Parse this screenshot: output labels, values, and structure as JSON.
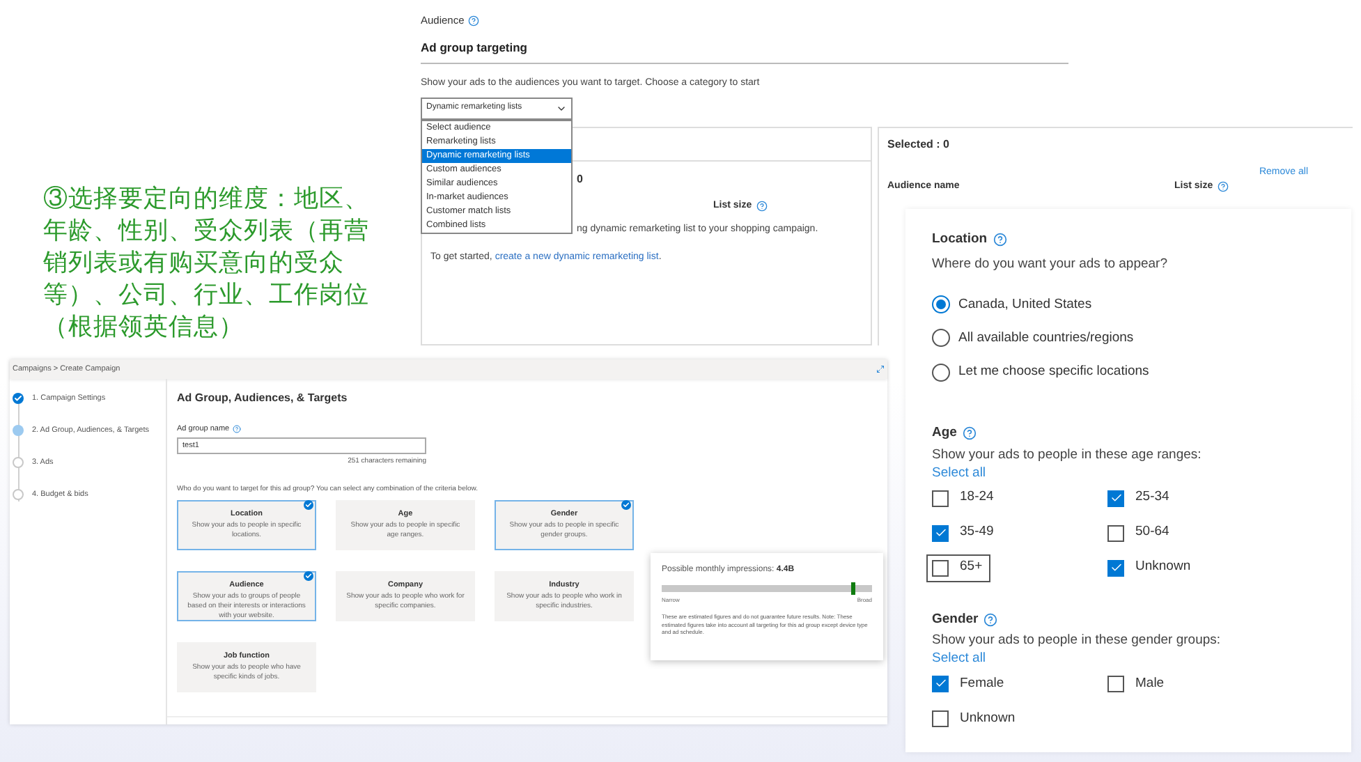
{
  "annotation": "③选择要定向的维度：地区、年龄、性别、受众列表（再营销列表或有购买意向的受众等）、公司、行业、工作岗位（根据领英信息）",
  "audience_panel": {
    "label": "Audience",
    "heading": "Ad group targeting",
    "instruction": "Show your ads to the audiences you want to target. Choose a category to start",
    "dropdown": {
      "value": "Dynamic remarketing lists",
      "expanded": true,
      "options": [
        {
          "label": "Select audience",
          "selected": false
        },
        {
          "label": "Remarketing lists",
          "selected": false
        },
        {
          "label": "Dynamic remarketing lists",
          "selected": true
        },
        {
          "label": "Custom audiences",
          "selected": false
        },
        {
          "label": "Similar audiences",
          "selected": false
        },
        {
          "label": "In-market audiences",
          "selected": false
        },
        {
          "label": "Customer match lists",
          "selected": false
        },
        {
          "label": "Combined lists",
          "selected": false
        }
      ]
    },
    "list_panel": {
      "count": "0",
      "list_size": "List size",
      "message": "ng dynamic remarketing list to your shopping campaign.",
      "prompt": "To get started,",
      "link": "create a new dynamic remarketing list",
      "link_end": "."
    },
    "selected_panel": {
      "title": "Selected : 0",
      "remove_all": "Remove all",
      "name_column": "Audience name",
      "size_column": "List size"
    }
  },
  "wizard": {
    "breadcrumb": "Campaigns > Create Campaign",
    "steps": [
      {
        "label": "1. Campaign Settings",
        "kind": "done"
      },
      {
        "label": "2. Ad Group, Audiences, & Targets",
        "kind": "current"
      },
      {
        "label": "3. Ads",
        "kind": "todo"
      },
      {
        "label": "4. Budget & bids",
        "kind": "todo"
      }
    ],
    "title": "Ad Group, Audiences, & Targets",
    "name_label": "Ad group name",
    "name_value": "test1",
    "remaining": "251 characters remaining",
    "question": "Who do you want to target for this ad group? You can select any combination of the criteria below.",
    "criteria": [
      {
        "title": "Location",
        "description": "Show your ads to people in specific locations.",
        "selected": true
      },
      {
        "title": "Age",
        "description": "Show your ads to people in specific age ranges.",
        "selected": false
      },
      {
        "title": "Gender",
        "description": "Show your ads to people in specific gender groups.",
        "selected": true
      },
      {
        "title": "Audience",
        "description": "Show your ads to groups of people based on their interests or interactions with your website.",
        "selected": true
      },
      {
        "title": "Company",
        "description": "Show your ads to people who work for specific companies.",
        "selected": false
      },
      {
        "title": "Industry",
        "description": "Show your ads to people who work in specific industries.",
        "selected": false
      },
      {
        "title": "Job function",
        "description": "Show your ads to people who have specific kinds of jobs.",
        "selected": false
      }
    ],
    "impressions": {
      "label": "Possible monthly impressions:",
      "value": "4.4B",
      "level": 0.9,
      "low": "Narrow",
      "high": "Broad",
      "note": "These are estimated figures and do not guarantee future results. Note: These estimated figures take into account all targeting for this ad group except device type and ad schedule."
    }
  },
  "targeting": {
    "location": {
      "title": "Location",
      "question": "Where do you want your ads to appear?",
      "options": [
        {
          "label": "Canada, United States",
          "selected": true
        },
        {
          "label": "All available countries/regions",
          "selected": false
        },
        {
          "label": "Let me choose specific locations",
          "selected": false
        }
      ]
    },
    "age": {
      "title": "Age",
      "question": "Show your ads to people in these age ranges:",
      "select_all": "Select all",
      "options": [
        {
          "label": "18-24",
          "checked": false,
          "focused": false
        },
        {
          "label": "25-34",
          "checked": true,
          "focused": false
        },
        {
          "label": "35-49",
          "checked": true,
          "focused": false
        },
        {
          "label": "50-64",
          "checked": false,
          "focused": false
        },
        {
          "label": "65+",
          "checked": false,
          "focused": true
        },
        {
          "label": "Unknown",
          "checked": true,
          "focused": false
        }
      ]
    },
    "gender": {
      "title": "Gender",
      "question": "Show your ads to people in these gender groups:",
      "select_all": "Select all",
      "options": [
        {
          "label": "Female",
          "checked": true,
          "focused": false
        },
        {
          "label": "Male",
          "checked": false,
          "focused": false
        },
        {
          "label": "Unknown",
          "checked": false,
          "focused": false
        }
      ]
    }
  }
}
